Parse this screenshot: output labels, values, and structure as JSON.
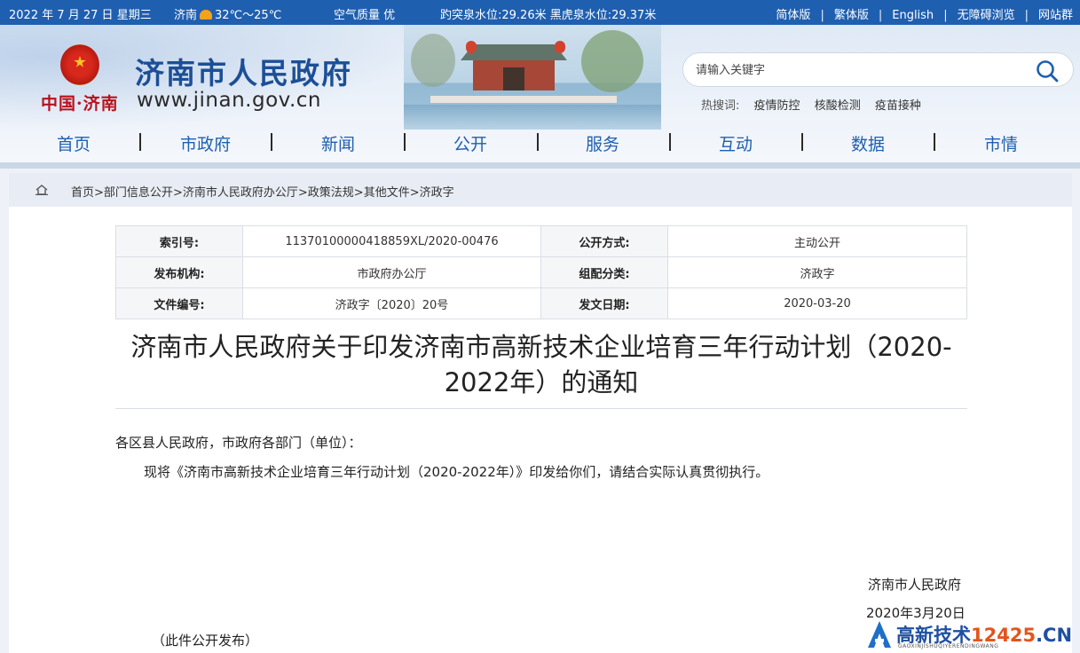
{
  "topbar": {
    "date": "2022 年 7 月 27 日 星期三",
    "city": "济南",
    "temp": "32℃～25℃",
    "air_quality": "空气质量 优",
    "water_level": "趵突泉水位:29.26米 黑虎泉水位:29.37米",
    "links": [
      "简体版",
      "繁体版",
      "English",
      "无障碍浏览",
      "网站群"
    ],
    "separator": "|"
  },
  "header": {
    "emblem_text": "中国·济南",
    "site_title": "济南市人民政府",
    "site_url": "www.jinan.gov.cn"
  },
  "search": {
    "placeholder": "请输入关键字",
    "hot_label": "热搜词:",
    "hot_words": [
      "疫情防控",
      "核酸检测",
      "疫苗接种"
    ]
  },
  "nav": {
    "items": [
      "首页",
      "市政府",
      "新闻",
      "公开",
      "服务",
      "互动",
      "数据",
      "市情"
    ]
  },
  "breadcrumb": {
    "items": [
      "首页",
      "部门信息公开",
      "济南市人民政府办公厅",
      "政策法规",
      "其他文件",
      "济政字"
    ],
    "sep": ">"
  },
  "meta": {
    "index_label": "索引号:",
    "index_value": "11370100000418859XL/2020-00476",
    "open_mode_label": "公开方式:",
    "open_mode_value": "主动公开",
    "issuer_label": "发布机构:",
    "issuer_value": "市政府办公厅",
    "category_label": "组配分类:",
    "category_value": "济政字",
    "doc_no_label": "文件编号:",
    "doc_no_value": "济政字〔2020〕20号",
    "date_label": "发文日期:",
    "date_value": "2020-03-20"
  },
  "document": {
    "title_line1": "济南市人民政府关于印发济南市高新技术企业培育三年行动计划（2020-",
    "title_line2": "2022年）的通知",
    "salutation": "各区县人民政府，市政府各部门（单位）：",
    "body": "现将《济南市高新技术企业培育三年行动计划（2020-2022年）》印发给你们，请结合实际认真贯彻执行。",
    "signatory": "济南市人民政府",
    "sign_date": "2020年3月20日",
    "note": "（此件公开发布）"
  },
  "watermark": {
    "text_main": "高新技术",
    "text_num": "12425",
    "text_tld": ".CN",
    "sub": "GAOXINJISHUQIYERENDINGWANG"
  },
  "colors": {
    "brand_blue": "#1f5fb0",
    "title_blue": "#1c4f96",
    "emblem_red": "#b8121e",
    "watermark_orange": "#e2551d"
  }
}
